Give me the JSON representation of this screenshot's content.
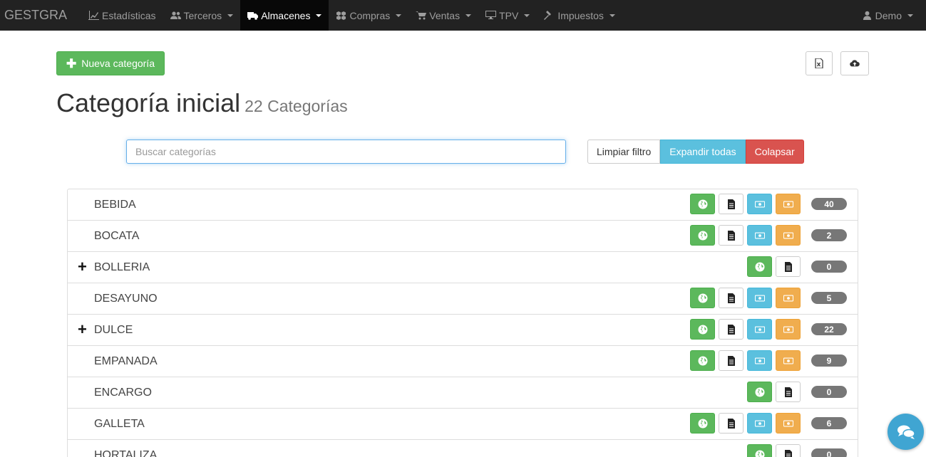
{
  "navbar": {
    "brand": "GESTGRA",
    "items": [
      {
        "label": "Estadísticas",
        "icon": "line-chart-icon",
        "dropdown": false
      },
      {
        "label": "Terceros",
        "icon": "users-icon",
        "dropdown": true
      },
      {
        "label": "Almacenes",
        "icon": "truck-icon",
        "dropdown": true,
        "active": true
      },
      {
        "label": "Compras",
        "icon": "cubes-icon",
        "dropdown": true
      },
      {
        "label": "Ventas",
        "icon": "shopping-cart-icon",
        "dropdown": true
      },
      {
        "label": "TPV",
        "icon": "desktop-icon",
        "dropdown": true
      },
      {
        "label": "Impuestos",
        "icon": "gavel-icon",
        "dropdown": true
      }
    ],
    "user": "Demo"
  },
  "toolbar": {
    "new_label": "Nueva categoría",
    "excel_icon": "excel-file-icon",
    "upload_icon": "cloud-upload-icon"
  },
  "page": {
    "title": "Categoría inicial",
    "subtitle": "22 Categorías"
  },
  "filter": {
    "placeholder": "Buscar categorías",
    "clear_label": "Limpiar filtro",
    "expand_label": "Expandir todas",
    "collapse_label": "Colapsar"
  },
  "colors": {
    "success": "#5cb85c",
    "info": "#5bc0de",
    "warning": "#f0ad4e",
    "danger": "#d9534f",
    "navbar": "#222222"
  },
  "categories": [
    {
      "name": "BEBIDA",
      "count": "40",
      "expandable": false,
      "prices": true
    },
    {
      "name": "BOCATA",
      "count": "2",
      "expandable": false,
      "prices": true
    },
    {
      "name": "BOLLERIA",
      "count": "0",
      "expandable": true,
      "prices": false
    },
    {
      "name": "DESAYUNO",
      "count": "5",
      "expandable": false,
      "prices": true
    },
    {
      "name": "DULCE",
      "count": "22",
      "expandable": true,
      "prices": true
    },
    {
      "name": "EMPANADA",
      "count": "9",
      "expandable": false,
      "prices": true
    },
    {
      "name": "ENCARGO",
      "count": "0",
      "expandable": false,
      "prices": false
    },
    {
      "name": "GALLETA",
      "count": "6",
      "expandable": false,
      "prices": true
    },
    {
      "name": "HORTALIZA",
      "count": "0",
      "expandable": false,
      "prices": false
    }
  ],
  "row_expander_symbol": "+"
}
